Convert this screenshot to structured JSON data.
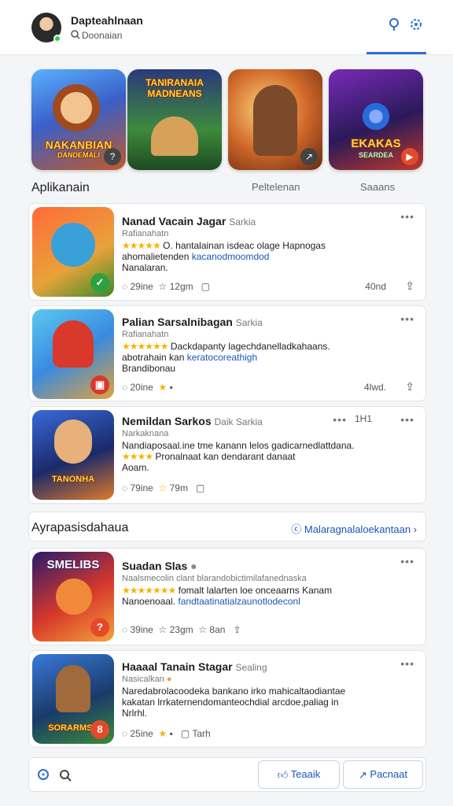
{
  "header": {
    "title": "Dapteahlnaan",
    "subtitle": "Doonaian",
    "search_icon": "search-icon",
    "settings_icon": "gear-icon"
  },
  "featured": [
    {
      "title": "NAKANBIAN",
      "sub": "DANDEMALI",
      "badge": "question-icon",
      "bg": "#3a5fc8"
    },
    {
      "title": "TANIRANAIA MADNEANS",
      "sub": "",
      "badge": "",
      "bg": "#2c6b3a"
    },
    {
      "title": "",
      "sub": "",
      "badge": "cursor-icon",
      "bg": "#d1692a"
    },
    {
      "title": "EKAKAS",
      "sub": "SEARDEA",
      "badge": "play-icon",
      "bg": "#5b2a8a"
    }
  ],
  "categories": [
    "Aplikanain",
    "Peltelenan",
    "Saaans"
  ],
  "list1": [
    {
      "title": "Nanad Vacain Jagar",
      "tag": "Sarkia",
      "sub": "Rafianahatn",
      "stars": "★★★★★",
      "desc_a": "O. hantalainan isdeac olage Hapnogas",
      "desc_b": "ahomalietenden",
      "desc_link": "kacanodmoomdod",
      "desc_c": "Nanalaran.",
      "foot": [
        "29ine",
        "12gm"
      ],
      "foot_right": "40nd"
    },
    {
      "title": "Palian Sarsalnibagan",
      "tag": "Sarkia",
      "sub": "Rafianahatn",
      "stars": "★★★★★★",
      "desc_a": "Dackdapanty lagechdanelladkahaans.",
      "desc_b": "Brandibonau",
      "desc_link": "keratocoreathigh",
      "desc_c": "abotrahain kan",
      "foot": [
        "20ine",
        ""
      ],
      "foot_right": "4lwd."
    },
    {
      "title": "Nemildan Sarkos",
      "tag": "Daik Sarkia",
      "sub": "Narkaknana",
      "stars": "★★★★",
      "desc_a": "Nandiaposaal.ine tme kanann lelos gadicarnedlattdana.",
      "desc_b": "Pronalnaat kan dendarant danaat",
      "desc_link": "",
      "desc_c": "Aoam.",
      "foot": [
        "79ine",
        "79m"
      ],
      "foot_right": "1H1"
    }
  ],
  "section": {
    "title": "Ayrapasisdahaua",
    "link": "Malaragnalaloekantaan"
  },
  "list2": [
    {
      "title": "Suadan Slas",
      "tag": "",
      "sub": "Naalsmecolin clant blarandobictimilafanednaska",
      "stars": "★★★★★★★",
      "desc_a": "fomalt lalarten loe onceaarns Kanam",
      "desc_link": "fandtaatinatialzaunotlodeconl",
      "desc_c": "Nanoenoaal.",
      "foot": [
        "39ine",
        "23gm",
        "8an"
      ],
      "thumb_title": "SMELIBS"
    },
    {
      "title": "Haaaal Tanain Stagar",
      "tag": "Sealing",
      "sub": "Nasicalkan",
      "stars": "",
      "desc_a": "Naredabrolacoodeka bankano irko mahicaltaodiantae",
      "desc_b": "kakatan lrrkaternendomanteochdial arcdoe,paliag in",
      "desc_c": "Nrlrhl.",
      "foot": [
        "25ine",
        "",
        "Tarh"
      ],
      "thumb_title": "SORARMSE"
    }
  ],
  "bottom": {
    "btn1": "Teaaik",
    "btn2": "Pacnaat"
  }
}
